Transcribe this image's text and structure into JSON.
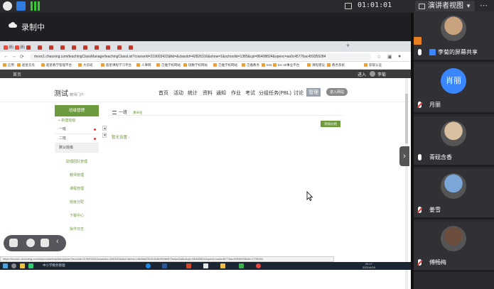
{
  "toolbar": {
    "timer": "01:01:01",
    "presenter_view_label": "演讲者视图",
    "more_icon": "more-dots-icon"
  },
  "recording": {
    "label": "录制中"
  },
  "browser": {
    "tabs": [
      {
        "label": "测试",
        "color": "#e74c3c"
      },
      {
        "label": "测试",
        "color": "#e74c3c"
      },
      {
        "label": "",
        "color": "#c0392b"
      },
      {
        "label": "",
        "color": "#c0392b"
      },
      {
        "label": "",
        "color": "#c0392b"
      },
      {
        "label": "",
        "color": "#c0392b"
      },
      {
        "label": "",
        "color": "#c0392b"
      },
      {
        "label": "",
        "color": "#c0392b"
      },
      {
        "label": "",
        "color": "#c0392b"
      },
      {
        "label": "",
        "color": "#c0392b"
      },
      {
        "label": "",
        "color": "#c0392b"
      },
      {
        "label": "",
        "color": "#c0392b"
      }
    ],
    "url": "mooc1.chaoxing.com/teachingClassManage/teachingClassList?courseId=219003422&fid=&classId=42826316&show=1&schoolid=1385&cpi=86408824&openc=aa0c45776ac459359284",
    "bookmarks": [
      "应用",
      "超星云舟",
      "超星教学管理平台",
      "大云班",
      "超星课程学习平台",
      "人事网",
      "泛雅学校网站",
      "瑞数学校网站",
      "泛雅学校网站",
      "泛雅教务",
      "test",
      "bin 30事业平台",
      "课程建设",
      "教务系统",
      "获取认证"
    ],
    "site": {
      "home": "首页",
      "right_link": "进入",
      "user": "李菊"
    },
    "course_header": {
      "title": "测试",
      "subtitle": "教师门户",
      "nav": [
        "首页",
        "活动",
        "统计",
        "资料",
        "通知",
        "作业",
        "考试",
        "分组任务(PBL)",
        "讨论"
      ],
      "manage": "管理",
      "pill": "进入网站"
    },
    "left_menu": {
      "head": "班级管理",
      "add_label": "+ 新建班级",
      "classes": [
        "一班",
        "二班",
        "默认班级"
      ],
      "links": [
        "助理团队管理",
        "教师管理",
        "课程管理",
        "班级分配",
        "下载中心",
        "操作日志"
      ]
    },
    "main": {
      "breadcrumb": "一班",
      "breadcrumb_action": "重命名",
      "group_button": "添加分组",
      "empty_text": "暂无设置 -"
    },
    "statusbar_url": "https://mooc1.chaoxing.com/mycourse/teachercourse?moocId=219003422&clazzid=42826316&ut=t&enc=d6c5a62912b3c5c059bf4f75a4a42a8c&cpi=86408824&openc=aa0c45776ac459359284&t=1739494"
  },
  "taskbar": {
    "app_label": "中小学教务管理",
    "clock_time": "20:17",
    "clock_date": "2021/4/19"
  },
  "participants": [
    {
      "name": "李菊的屏幕共享",
      "sharing": true
    },
    {
      "name": "月丽",
      "avatar_text": "肖丽",
      "muted": true
    },
    {
      "name": "青砚含香",
      "muted": false
    },
    {
      "name": "姜雪",
      "muted": true
    },
    {
      "name": "傅畅梅",
      "muted": true
    }
  ]
}
